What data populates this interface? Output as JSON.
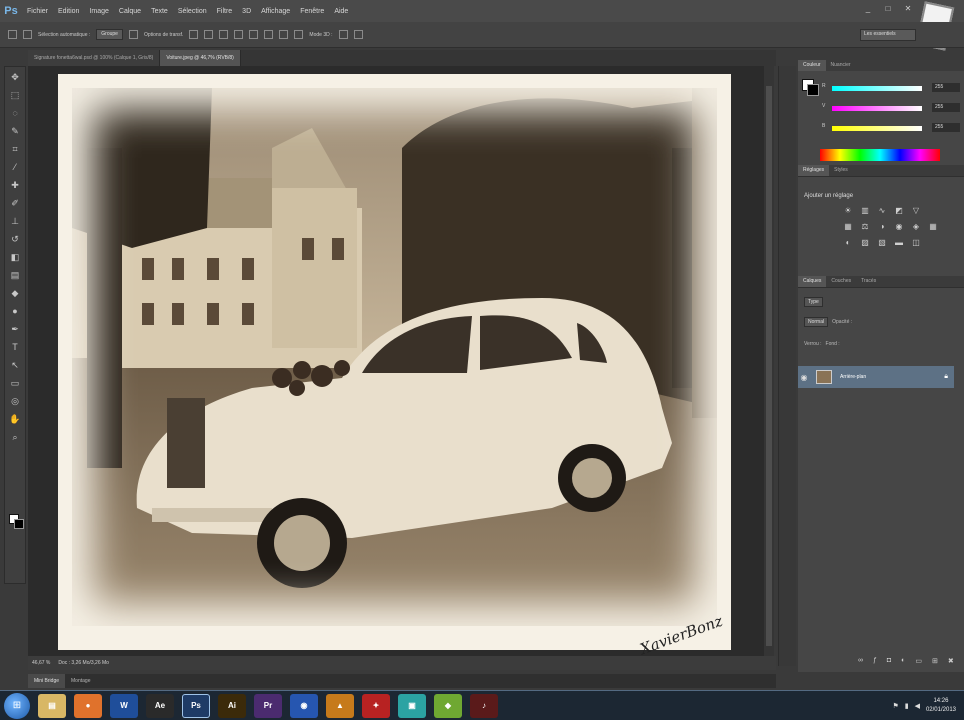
{
  "app": {
    "logo_text": "Ps"
  },
  "menu": [
    "Fichier",
    "Edition",
    "Image",
    "Calque",
    "Texte",
    "Sélection",
    "Filtre",
    "3D",
    "Affichage",
    "Fenêtre",
    "Aide"
  ],
  "options": {
    "auto_select_label": "Sélection automatique :",
    "auto_select_value": "Groupe",
    "transform_label": "Options de transf.",
    "mode_3d_label": "Mode 3D :",
    "workspace": "Les essentiels"
  },
  "tabs": [
    {
      "label": "Signature fonetta6wal.psd @ 100% (Calque 1, Gris/8)"
    },
    {
      "label": "Voiture.jpeg @ 46,7% (RVB/8)"
    }
  ],
  "status": {
    "zoom": "46,67 %",
    "doc": "Doc : 3,26 Mo/3,26 Mo"
  },
  "bottom_tabs": [
    "Mini Bridge",
    "Montage"
  ],
  "signature_text": "XavierBonz",
  "colors": {
    "accent": "#5d7185",
    "bg": "#3a3a3a"
  },
  "panels": {
    "color_tabs": [
      "Couleur",
      "Nuancier"
    ],
    "sliders": [
      {
        "label": "R",
        "value": "255",
        "gradient": "#00ffff,#ffffff"
      },
      {
        "label": "V",
        "value": "255",
        "gradient": "#ff00ff,#ffffff"
      },
      {
        "label": "B",
        "value": "255",
        "gradient": "#ffff00,#ffffff"
      }
    ],
    "adjust_tabs": [
      "Réglages",
      "Styles"
    ],
    "adjust_title": "Ajouter un réglage",
    "layers_tabs": [
      "Calques",
      "Couches",
      "Tracés"
    ],
    "kind": "Type",
    "blend_mode": "Normal",
    "opacity_label": "Opacité :",
    "lock_label": "Verrou :",
    "fill_label": "Fond :",
    "layer_name": "Arrière-plan"
  },
  "tray": {
    "time": "14:26",
    "date": "02/01/2013"
  }
}
